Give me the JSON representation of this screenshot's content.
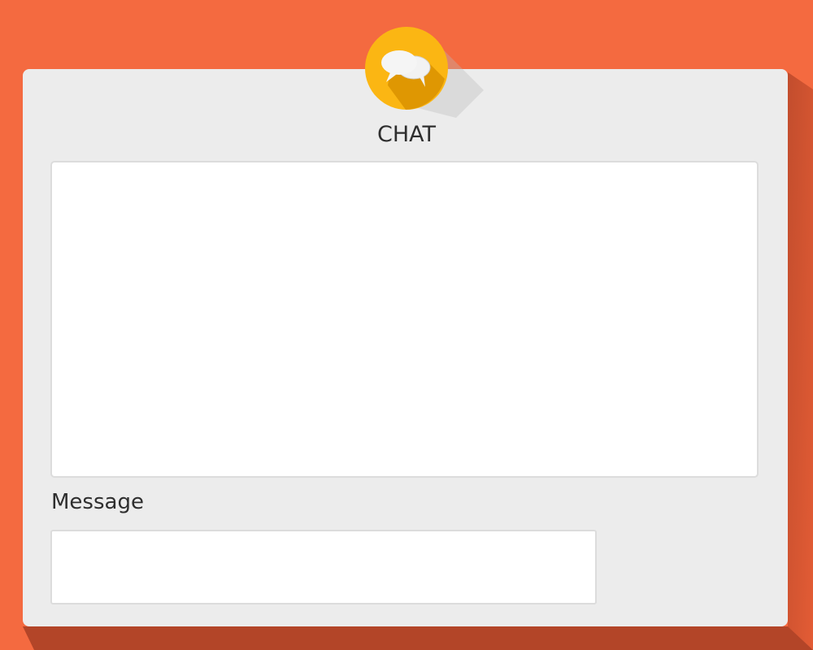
{
  "app": {
    "title": "CHAT"
  },
  "chat_icon": {
    "icon": "chat-bubbles-icon",
    "color": "#fbb613",
    "shadow_color": "#d98f00"
  },
  "chat_log": {
    "messages": []
  },
  "message": {
    "label": "Message",
    "value": "",
    "placeholder": ""
  },
  "colors": {
    "background": "#f46a40",
    "card": "#ececec",
    "card_shadow": "#bf4b2b",
    "panel": "#ffffff",
    "panel_border": "#dcdcdc",
    "text": "#2e2e2e"
  }
}
